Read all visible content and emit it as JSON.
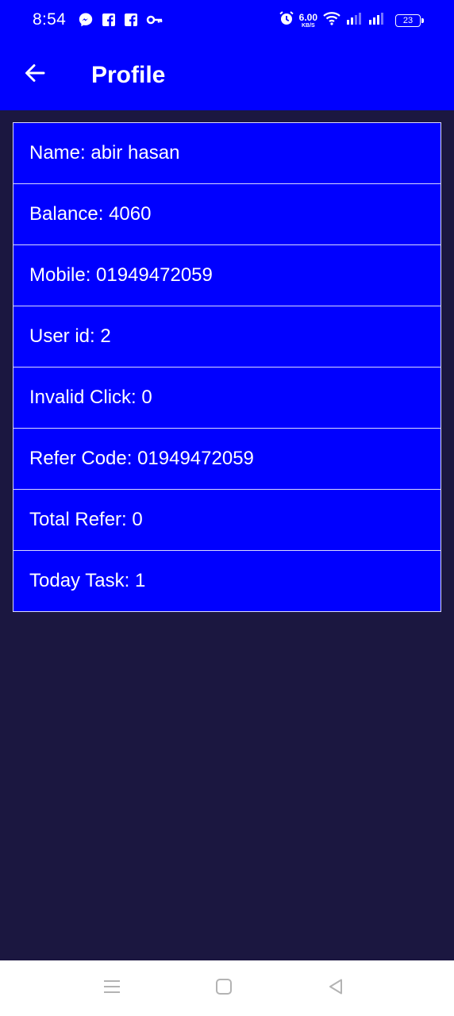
{
  "status_bar": {
    "time": "8:54",
    "net_speed_value": "6.00",
    "net_speed_unit": "KB/S",
    "battery": "23",
    "left_icons": [
      "messenger-icon",
      "facebook-icon",
      "facebook-icon",
      "key-icon"
    ],
    "right_icons": [
      "alarm-icon",
      "wifi-icon",
      "signal-icon",
      "signal-icon",
      "battery-icon"
    ]
  },
  "app_bar": {
    "title": "Profile",
    "back_icon": "arrow-left-icon"
  },
  "profile": {
    "rows": [
      {
        "label": "Name: abir hasan"
      },
      {
        "label": "Balance: 4060"
      },
      {
        "label": "Mobile: 01949472059"
      },
      {
        "label": "User id: 2"
      },
      {
        "label": "Invalid Click: 0"
      },
      {
        "label": "Refer Code: 01949472059"
      },
      {
        "label": "Total Refer: 0"
      },
      {
        "label": "Today Task: 1"
      }
    ]
  },
  "navigation": {
    "buttons": [
      "menu-icon",
      "home-icon",
      "back-icon"
    ]
  },
  "colors": {
    "primary": "#0000ff",
    "background": "#1b1740",
    "text": "#ffffff",
    "nav_background": "#ffffff"
  }
}
